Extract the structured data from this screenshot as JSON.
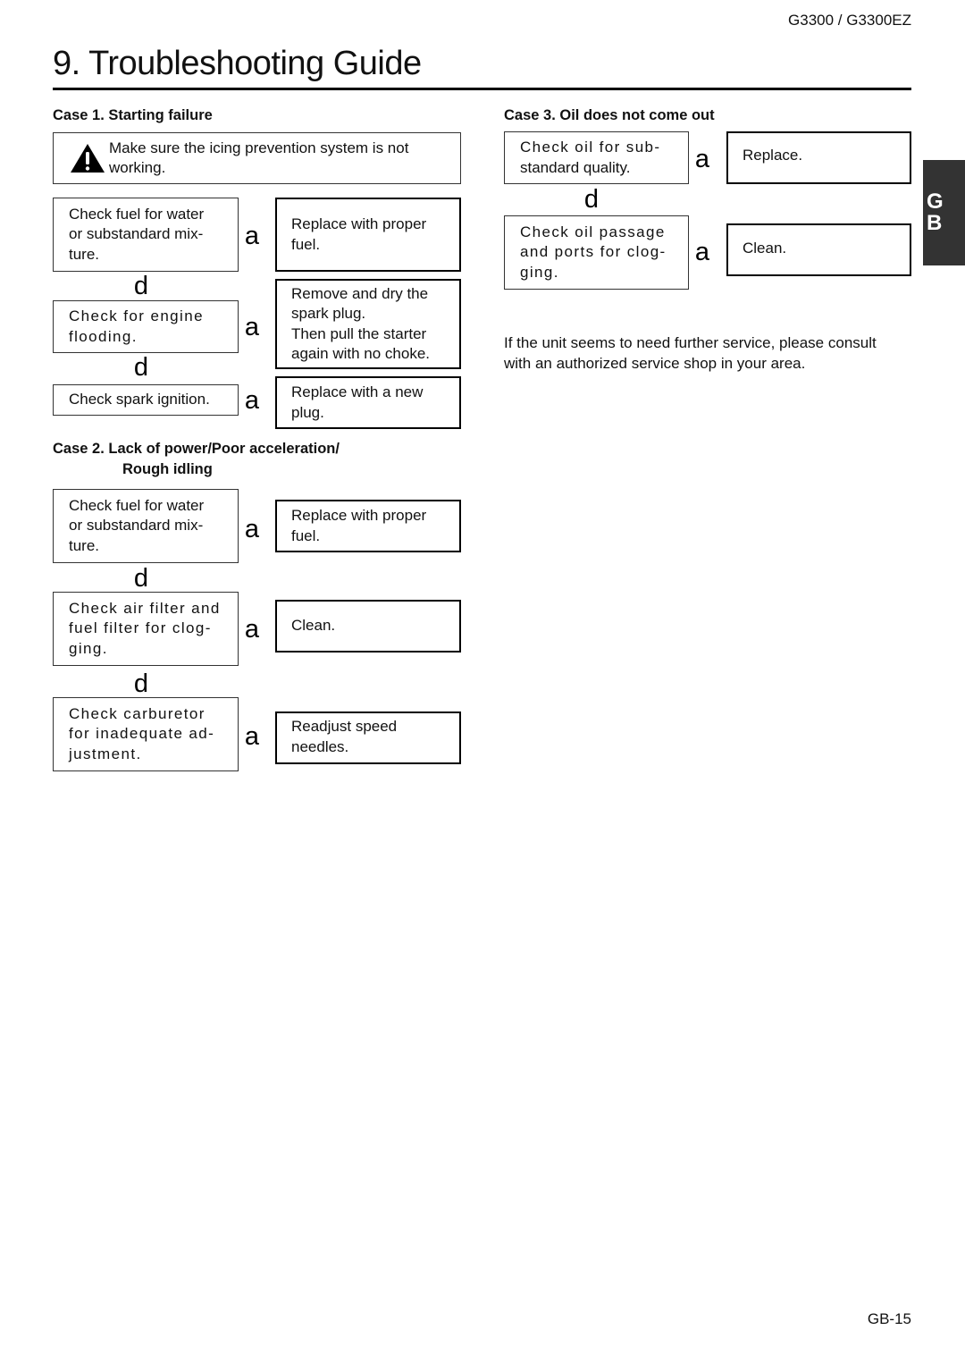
{
  "header": {
    "model": "G3300 / G3300EZ",
    "title": "9. Troubleshooting Guide"
  },
  "side_tab": {
    "lines": [
      "G",
      "B"
    ]
  },
  "arrows": {
    "next": "a",
    "down": "d"
  },
  "case1": {
    "heading": "Case 1.  Starting failure",
    "warning": {
      "icon": "warning-triangle-icon",
      "text": "Make sure the icing prevention system is not working."
    },
    "steps": [
      {
        "check": [
          "Check fuel for water",
          "or substandard mix-",
          "ture."
        ],
        "action": [
          "Replace with proper",
          "fuel."
        ]
      },
      {
        "check": [
          "Check for engine",
          "flooding."
        ],
        "action": [
          "Remove and dry the",
          "spark plug.",
          "Then pull the starter",
          "again with no choke."
        ]
      },
      {
        "check": [
          "Check spark ignition."
        ],
        "action": [
          "Replace with a new",
          "plug."
        ]
      }
    ]
  },
  "case2": {
    "heading_line1": "Case 2.  Lack of power/Poor acceleration/",
    "heading_line2": "Rough idling",
    "steps": [
      {
        "check": [
          "Check fuel for water",
          "or substandard mix-",
          "ture."
        ],
        "action": [
          "Replace with proper",
          "fuel."
        ]
      },
      {
        "check": [
          "Check air filter and",
          "fuel filter for clog-",
          "ging."
        ],
        "action": [
          "Clean."
        ]
      },
      {
        "check": [
          "Check carburetor",
          "for inadequate ad-",
          "justment."
        ],
        "action": [
          "Readjust speed",
          "needles."
        ]
      }
    ]
  },
  "case3": {
    "heading": "Case 3.  Oil does not come out",
    "steps": [
      {
        "check": [
          "Check oil for sub-",
          "standard quality."
        ],
        "action": [
          "Replace."
        ]
      },
      {
        "check": [
          "Check oil passage",
          "and ports for clog-",
          "ging."
        ],
        "action": [
          "Clean."
        ]
      }
    ]
  },
  "service_note": {
    "lines": [
      "If the unit seems to need further service, please consult",
      "with an authorized service shop in your area."
    ]
  },
  "footer": {
    "page": "GB-15"
  }
}
